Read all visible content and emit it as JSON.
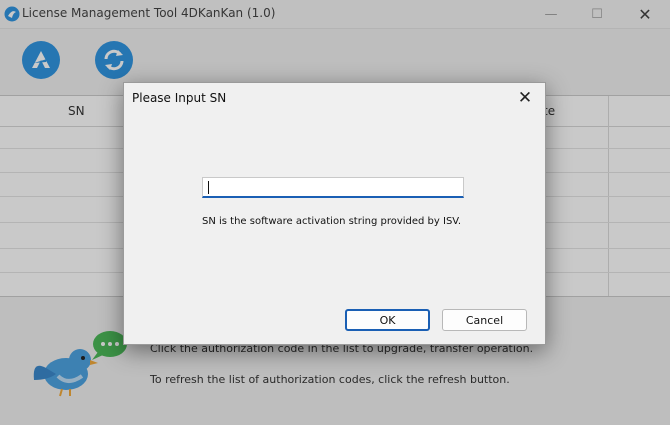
{
  "window": {
    "title": "License Management Tool 4DKanKan (1.0)",
    "minimize_glyph": "—",
    "maximize_glyph": "☐",
    "close_glyph": "✕"
  },
  "toolbar": {
    "activate_icon": "activate-logo-icon",
    "refresh_icon": "refresh-icon"
  },
  "grid": {
    "columns": [
      "SN",
      "te"
    ]
  },
  "hints": [
    "Click the authorization code in the list to upgrade, transfer operation.",
    "To refresh the list of authorization codes, click the refresh button."
  ],
  "dialog": {
    "title": "Please Input SN",
    "close_glyph": "✕",
    "input_value": "",
    "description": "SN is the software activation string provided by ISV.",
    "ok_label": "OK",
    "cancel_label": "Cancel"
  },
  "colors": {
    "accent": "#1e8ce0",
    "focus_border": "#1a5fb4"
  }
}
